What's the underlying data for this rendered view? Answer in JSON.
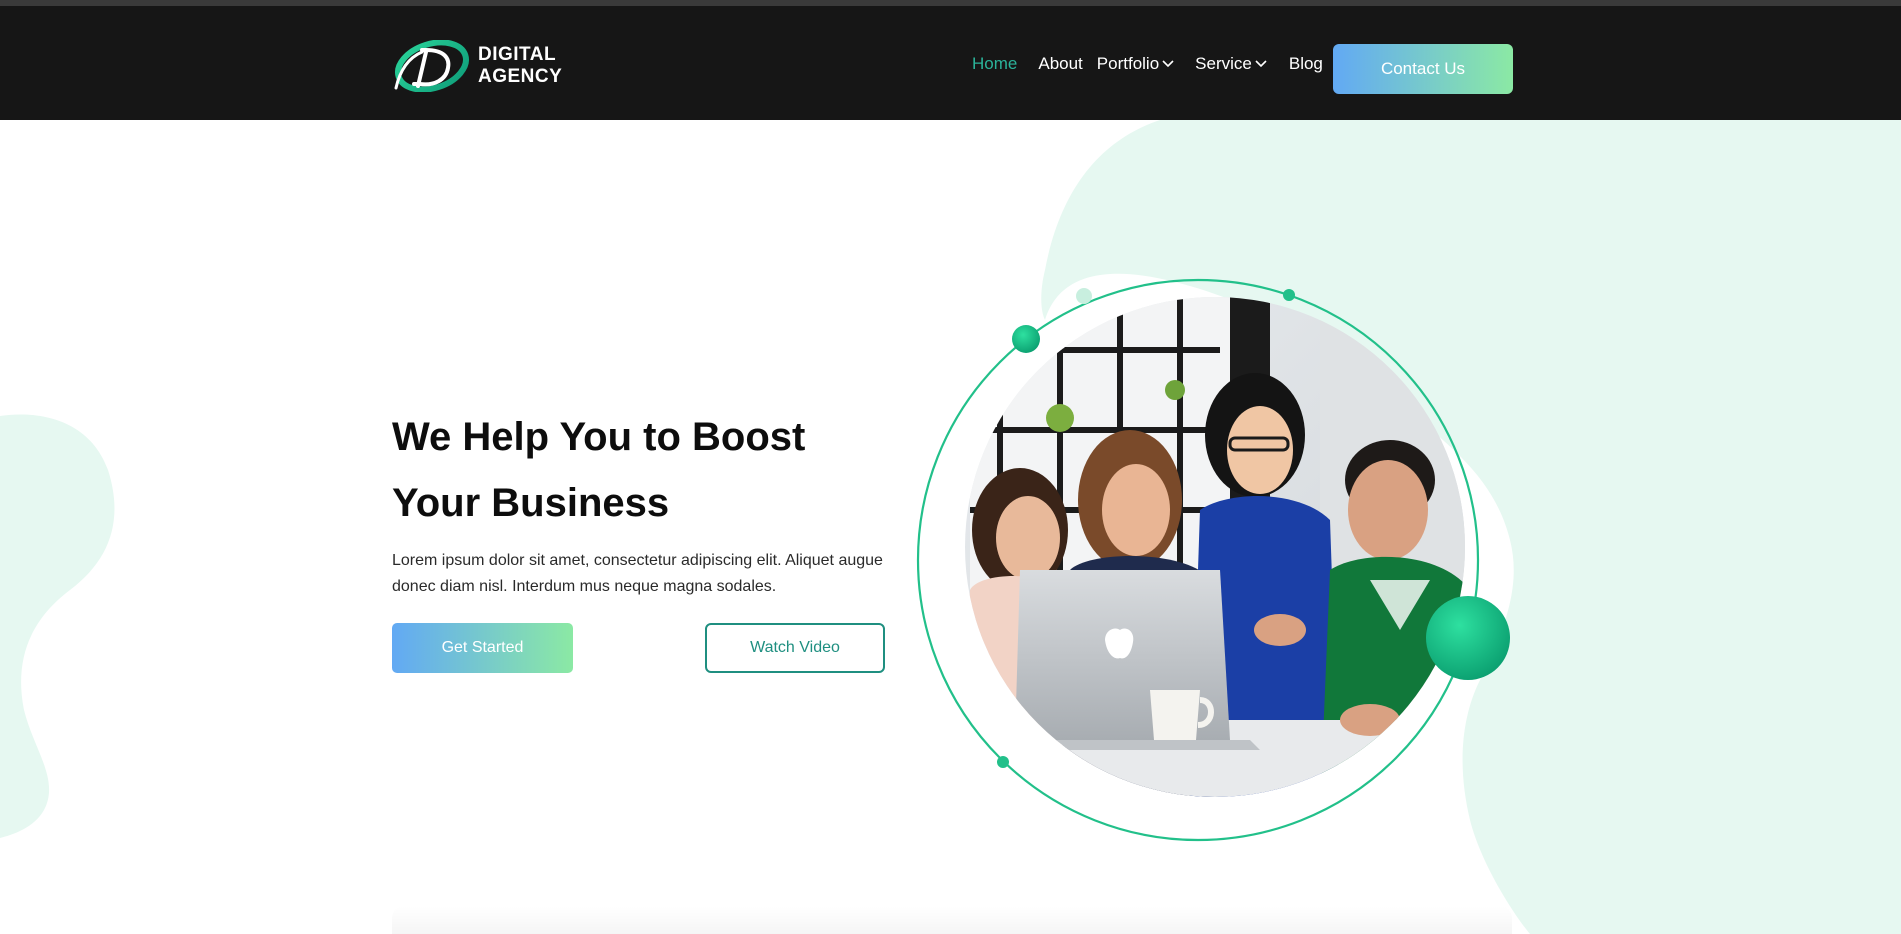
{
  "brand": {
    "name_line1": "DIGITAL",
    "name_line2": "AGENCY",
    "logo_icon": "d-swoosh-logo"
  },
  "nav": {
    "items": [
      {
        "label": "Home",
        "active": true
      },
      {
        "label": "About",
        "active": false
      },
      {
        "label": "Portfolio",
        "active": false,
        "dropdown": true
      },
      {
        "label": "Service",
        "active": false,
        "dropdown": true
      },
      {
        "label": "Blog",
        "active": false
      }
    ],
    "cta_label": "Contact Us"
  },
  "hero": {
    "title_line1": "We Help You to Boost",
    "title_line2": "Your Business",
    "description": "Lorem ipsum dolor sit amet, consectetur adipiscing elit. Aliquet augue donec diam nisl. Interdum mus neque magna sodales.",
    "primary_button": "Get Started",
    "secondary_button": "Watch Video"
  },
  "colors": {
    "navbar_bg": "#161616",
    "accent": "#2bb39a",
    "gradient_start": "#62a9f4",
    "gradient_end": "#8be9a4",
    "blob": "#e6f8f1",
    "ring": "#22c08a"
  },
  "icons": {
    "dropdown": "chevron-down-icon"
  }
}
